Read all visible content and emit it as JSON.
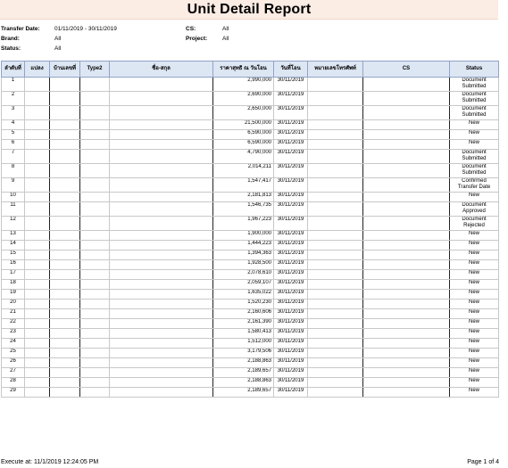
{
  "report": {
    "title": "Unit Detail Report"
  },
  "filters": {
    "transfer_date_label": "Transfer Date:",
    "transfer_date_value": "01/11/2019 - 30/11/2019",
    "brand_label": "Brand:",
    "brand_value": "All",
    "status_label": "Status:",
    "status_value": "All",
    "cs_label": "CS:",
    "cs_value": "All",
    "project_label": "Project:",
    "project_value": "All"
  },
  "table": {
    "headers": [
      "ลำดับที่",
      "แปลง",
      "บ้านเลขที่",
      "Type2",
      "ชื่อ-สกุล",
      "ราคาสุทธิ ณ วันโอน",
      "วันที่โอน",
      "หมายเลขโทรศัพท์",
      "CS",
      "Status"
    ],
    "rows": [
      {
        "no": "1",
        "price": "2,990,000",
        "date": "30/11/2019",
        "status": "Document Submitted"
      },
      {
        "no": "2",
        "price": "2,690,000",
        "date": "30/11/2019",
        "status": "Document Submitted"
      },
      {
        "no": "3",
        "price": "2,650,000",
        "date": "30/11/2019",
        "status": "Document Submitted"
      },
      {
        "no": "4",
        "price": "21,500,000",
        "date": "30/11/2019",
        "status": "New"
      },
      {
        "no": "5",
        "price": "6,590,000",
        "date": "30/11/2019",
        "status": "New"
      },
      {
        "no": "6",
        "price": "6,590,000",
        "date": "30/11/2019",
        "status": "New"
      },
      {
        "no": "7",
        "price": "4,790,000",
        "date": "30/11/2019",
        "status": "Document Submitted"
      },
      {
        "no": "8",
        "price": "2,014,211",
        "date": "30/11/2019",
        "status": "Document Submitted"
      },
      {
        "no": "9",
        "price": "1,547,417",
        "date": "30/11/2019",
        "status": "Confirmed Transfer Date"
      },
      {
        "no": "10",
        "price": "2,181,813",
        "date": "30/11/2019",
        "status": "New"
      },
      {
        "no": "11",
        "price": "1,546,735",
        "date": "30/11/2019",
        "status": "Document Approved"
      },
      {
        "no": "12",
        "price": "1,967,223",
        "date": "30/11/2019",
        "status": "Document Rejected"
      },
      {
        "no": "13",
        "price": "1,900,000",
        "date": "30/11/2019",
        "status": "New"
      },
      {
        "no": "14",
        "price": "1,444,223",
        "date": "30/11/2019",
        "status": "New"
      },
      {
        "no": "15",
        "price": "1,394,363",
        "date": "30/11/2019",
        "status": "New"
      },
      {
        "no": "16",
        "price": "1,928,500",
        "date": "30/11/2019",
        "status": "New"
      },
      {
        "no": "17",
        "price": "2,078,610",
        "date": "30/11/2019",
        "status": "New"
      },
      {
        "no": "18",
        "price": "2,059,107",
        "date": "30/11/2019",
        "status": "New"
      },
      {
        "no": "19",
        "price": "1,635,022",
        "date": "30/11/2019",
        "status": "New"
      },
      {
        "no": "20",
        "price": "1,520,230",
        "date": "30/11/2019",
        "status": "New"
      },
      {
        "no": "21",
        "price": "2,160,606",
        "date": "30/11/2019",
        "status": "New"
      },
      {
        "no": "22",
        "price": "2,161,390",
        "date": "30/11/2019",
        "status": "New"
      },
      {
        "no": "23",
        "price": "1,580,413",
        "date": "30/11/2019",
        "status": "New"
      },
      {
        "no": "24",
        "price": "1,512,000",
        "date": "30/11/2019",
        "status": "New"
      },
      {
        "no": "25",
        "price": "3,179,506",
        "date": "30/11/2019",
        "status": "New"
      },
      {
        "no": "26",
        "price": "2,188,863",
        "date": "30/11/2019",
        "status": "New"
      },
      {
        "no": "27",
        "price": "2,189,657",
        "date": "30/11/2019",
        "status": "New"
      },
      {
        "no": "28",
        "price": "2,188,863",
        "date": "30/11/2019",
        "status": "New"
      },
      {
        "no": "29",
        "price": "2,189,657",
        "date": "30/11/2019",
        "status": "New"
      }
    ]
  },
  "footer": {
    "executed": "Execute at: 11/1/2019 12:24:05 PM",
    "page": "Page 1 of 4"
  }
}
